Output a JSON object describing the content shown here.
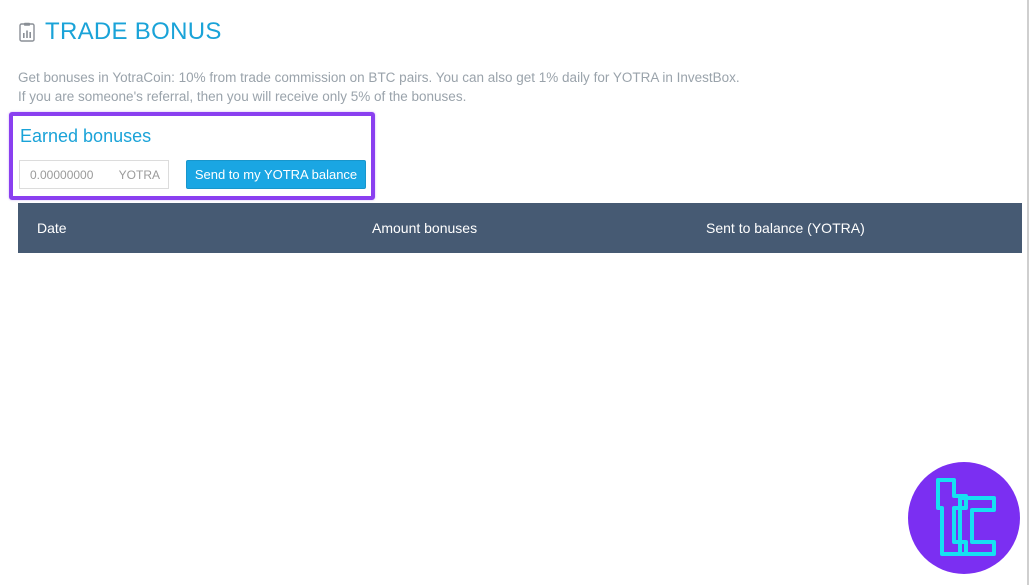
{
  "page": {
    "title": "TRADE BONUS",
    "title_icon": "clipboard-chart-icon",
    "description_line1": "Get bonuses in YotraCoin: 10% from trade commission on BTC pairs. You can also get 1% daily for YOTRA in InvestBox.",
    "description_line2": "If you are someone's referral, then you will receive only 5% of the bonuses."
  },
  "earned": {
    "title": "Earned bonuses",
    "amount": "0.00000000",
    "unit": "YOTRA",
    "send_button_label": "Send to my YOTRA balance"
  },
  "table": {
    "columns": [
      "Date",
      "Amount bonuses",
      "Sent to balance (YOTRA)"
    ],
    "rows": []
  },
  "colors": {
    "accent": "#1aa3d8",
    "button": "#1aa6e3",
    "table_header": "#465a73",
    "highlight_border": "#8a3ff0",
    "watermark": "#7b2ff2"
  },
  "watermark": {
    "icon": "tc-logo-icon"
  }
}
